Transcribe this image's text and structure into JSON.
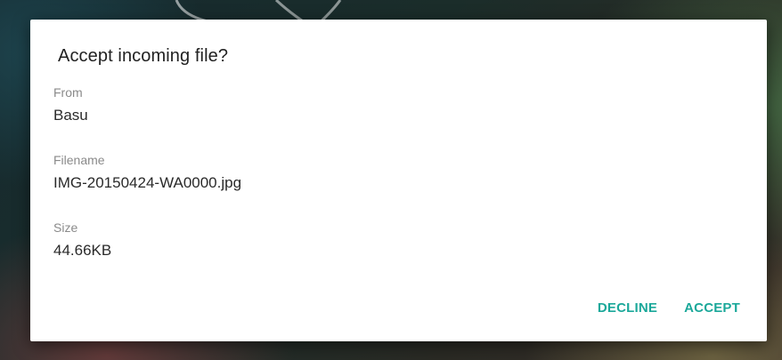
{
  "dialog": {
    "title": "Accept incoming file?",
    "fields": {
      "from": {
        "label": "From",
        "value": "Basu"
      },
      "filename": {
        "label": "Filename",
        "value": "IMG-20150424-WA0000.jpg"
      },
      "size": {
        "label": "Size",
        "value": "44.66KB"
      }
    },
    "actions": {
      "decline_label": "DECLINE",
      "accept_label": "ACCEPT"
    }
  },
  "colors": {
    "accent": "#1ba89a",
    "dialog_background": "#ffffff",
    "title_text": "#212121",
    "label_text": "#8a8a8a",
    "value_text": "#2a2a2a"
  }
}
